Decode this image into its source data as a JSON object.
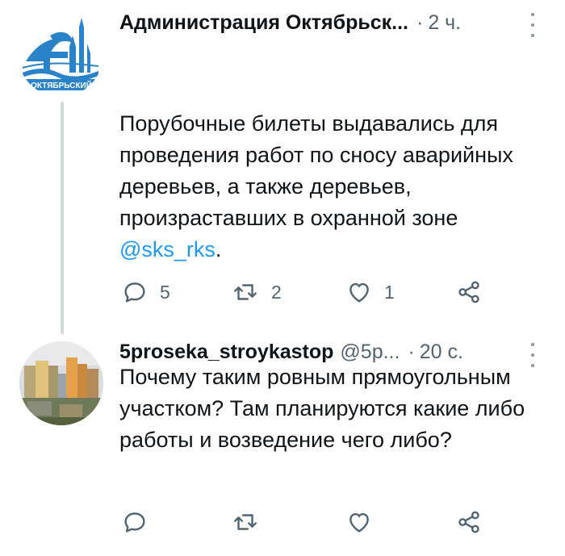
{
  "tweets": [
    {
      "display_name": "Администрация Октябрьск...",
      "handle": "",
      "dot": "·",
      "time": "2 ч.",
      "avatar": {
        "icon": "city-logo-icon",
        "caption": "ОКТЯБРЬСКИЙ",
        "color": "#2a83c8"
      },
      "text_before": "Порубочные билеты выдавались для проведения работ по сносу аварийных деревьев, а также деревьев, произраставших в охранной зоне ",
      "mention": "@sks_rks",
      "text_after": ".",
      "actions": {
        "reply_count": "5",
        "retweet_count": "2",
        "like_count": "1"
      }
    },
    {
      "display_name": "5proseka_stroykastop",
      "handle": "@5р...",
      "dot": "·",
      "time": "20 с.",
      "avatar": {
        "icon": "buildings-photo-icon"
      },
      "text_before": "Почему таким ровным прямоугольным участком? Там планируются какие либо работы и возведение чего либо?",
      "mention": "",
      "text_after": "",
      "actions": {
        "reply_count": "",
        "retweet_count": "",
        "like_count": ""
      }
    }
  ],
  "colors": {
    "link": "#1d9bf0",
    "secondary": "#536471",
    "thread_line": "#cfd9de"
  }
}
